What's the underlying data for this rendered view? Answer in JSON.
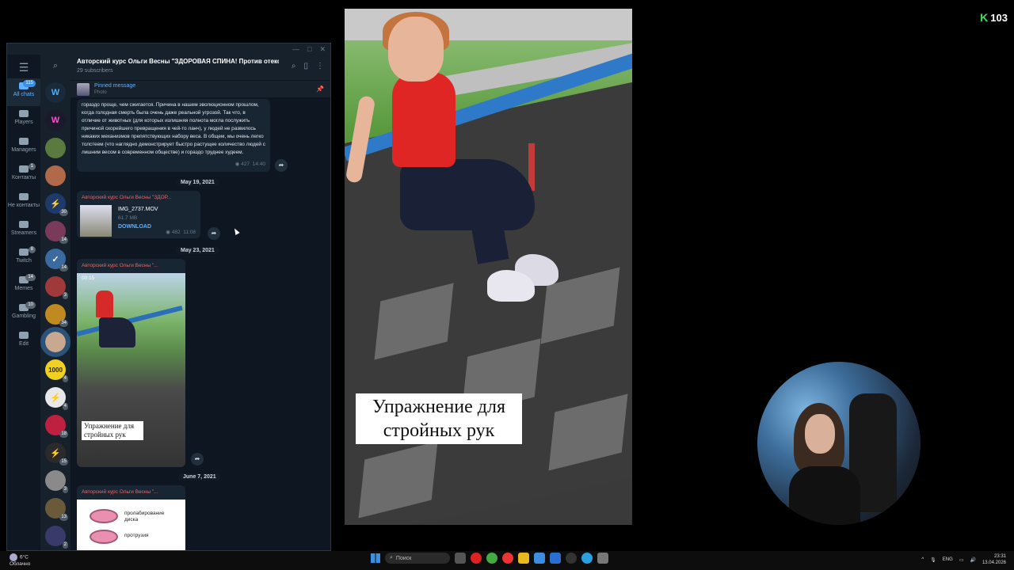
{
  "logo": {
    "brand_icon": "K",
    "text": "103",
    "accent": "#3ddc5c"
  },
  "telegram": {
    "folders": [
      {
        "label": "All chats",
        "count": "115",
        "active": true
      },
      {
        "label": "Players",
        "count": ""
      },
      {
        "label": "Managers",
        "count": ""
      },
      {
        "label": "Контакты",
        "count": "1"
      },
      {
        "label": "Не контакты",
        "count": ""
      },
      {
        "label": "Streamers",
        "count": ""
      },
      {
        "label": "Twitch",
        "count": "8"
      },
      {
        "label": "Memes",
        "count": "14"
      },
      {
        "label": "Gambling",
        "count": "10"
      },
      {
        "label": "Edit",
        "count": ""
      }
    ],
    "chat_badges": [
      "",
      "",
      "",
      "",
      "30",
      "14",
      "14",
      "3",
      "34",
      "",
      "4",
      "4",
      "18",
      "15",
      "3",
      "13",
      "2"
    ],
    "chat": {
      "title": "Авторский курс Ольги Весны \"ЗДОРОВАЯ СПИНА! Против отеков ...",
      "subscribers": "29 subscribers",
      "pinned_title": "Pinned message",
      "pinned_sub": "Photo",
      "text_message": "гораздо проще, чем сжигается. Причина в нашем эволюционном прошлом, когда голодная смерть была очень даже реальной угрозой. Так что, в отличие от животных (для которых излишняя полнота могла послужить причиной скорейшего превращения в чей-то ланч), у людей не развилось никаких механизмов препятствующих набору веса. В общем, мы очень легко толстеем (что наглядно демонстрирует быстро растущее количество людей с лишним весом в современном обществе) и гораздо труднее худеем.",
      "text_views": "427",
      "text_time": "14:40",
      "date1": "May 19, 2021",
      "file_sender": "Авторский курс Ольги Весны \"ЗДОР...",
      "file_name": "IMG_2737.MOV",
      "file_size": "61.7 MB",
      "file_download": "DOWNLOAD",
      "file_views": "482",
      "file_time": "11:08",
      "date2": "May 23, 2021",
      "video_sender": "Авторский курс Ольги Весны \"...",
      "video_duration": "00:15",
      "video_caption": "Упражнение для стройных рук",
      "date3": "June 7, 2021",
      "image_sender": "Авторский курс Ольги Весны \"...",
      "image_label1": "пролабирование диска",
      "image_label2": "протрузия"
    }
  },
  "video_caption": "Упражнение для стройных рук",
  "taskbar": {
    "weather_temp": "6°C",
    "weather_desc": "Облачно",
    "search_placeholder": "Поиск",
    "lang": "ENG",
    "time": "23:31",
    "date": "13.04.2026"
  }
}
